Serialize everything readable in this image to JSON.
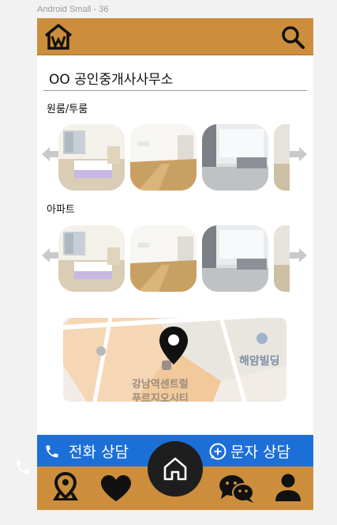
{
  "frame": {
    "label": "Android Small - 36"
  },
  "header": {
    "logo_icon": "house-logo-icon",
    "search_icon": "search-icon",
    "background": "#cc8e3d"
  },
  "office": {
    "name": "OO 공인중개사사무소"
  },
  "sections": [
    {
      "title": "원룸/투룸",
      "thumbnails": [
        "room-photo-bedroom",
        "room-photo-living-wood-floor",
        "room-photo-living-sofa",
        "room-photo-partial"
      ]
    },
    {
      "title": "아파트",
      "thumbnails": [
        "apt-photo-bedroom",
        "apt-photo-living-wood-floor",
        "apt-photo-living-sofa",
        "apt-photo-partial"
      ]
    }
  ],
  "map": {
    "labels": {
      "building": "해암빌딩",
      "center_line1": "강남역센트럴",
      "center_line2": "푸르지오시티"
    }
  },
  "contact": {
    "phone_label": "전화 상담",
    "sms_label": "문자 상담",
    "background": "#1d6fd8"
  },
  "bottom_nav": {
    "items": [
      "map-pin-icon",
      "heart-icon",
      "home-icon",
      "chat-icon",
      "user-icon"
    ],
    "background": "#cc8e3d"
  }
}
